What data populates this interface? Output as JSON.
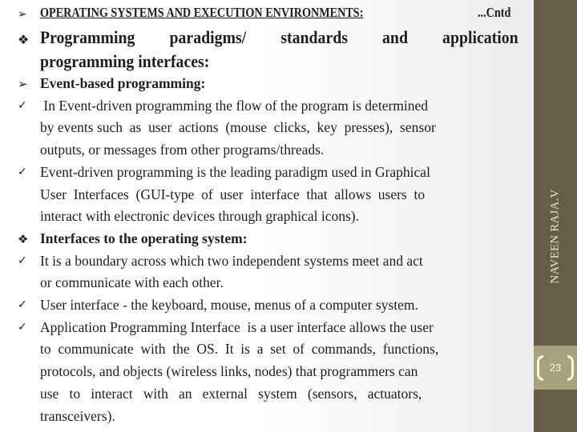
{
  "slide": {
    "title": "OPERATING SYSTEMS AND EXECUTION ENVIRONMENTS:",
    "title_suffix": "...Cntd",
    "heading_line1_words": [
      "Programming",
      "paradigms/",
      "standards",
      "and",
      "application"
    ],
    "heading_line2": "programming interfaces:",
    "lines": [
      {
        "bullet": "arrow",
        "text": "Event-based programming:",
        "bold": true
      },
      {
        "bullet": "check",
        "text": " In Event-driven programming the flow of the program is determined"
      },
      {
        "bullet": "",
        "text": "by events such  as  user  actions  (mouse  clicks,  key  presses),  sensor"
      },
      {
        "bullet": "",
        "text": "outputs, or messages from other programs/threads."
      },
      {
        "bullet": "check",
        "text": "Event-driven programming is the leading paradigm used in Graphical"
      },
      {
        "bullet": "",
        "text": "User  Interfaces  (GUI-type  of  user  interface  that  allows  users  to"
      },
      {
        "bullet": "",
        "text": "interact with electronic devices through graphical icons)."
      },
      {
        "bullet": "diamond",
        "text": "Interfaces to the operating system:",
        "bold": true
      },
      {
        "bullet": "check",
        "text": "It is a boundary across which two independent systems meet and act"
      },
      {
        "bullet": "",
        "text": "or communicate with each other."
      },
      {
        "bullet": "check",
        "text": "User interface - the keyboard, mouse, menus of a computer system."
      },
      {
        "bullet": "check",
        "text": "Application Programming Interface  is a user interface allows the user"
      },
      {
        "bullet": "",
        "text": "to  communicate  with  the  OS.  It  is  a  set  of  commands,  functions,"
      },
      {
        "bullet": "",
        "text": "protocols, and objects (wireless links, nodes) that programmers can"
      },
      {
        "bullet": "",
        "text": "use   to   interact   with   an   external   system   (sensors,   actuators,"
      },
      {
        "bullet": "",
        "text": "transceivers)."
      }
    ]
  },
  "sidebar": {
    "author": "NAVEEN RAJA.V",
    "page_number": "23",
    "color": "#665e48",
    "page_box_color": "#a8a17e"
  },
  "icons": {
    "arrow": "➢",
    "check": "✓",
    "diamond": "❖"
  }
}
